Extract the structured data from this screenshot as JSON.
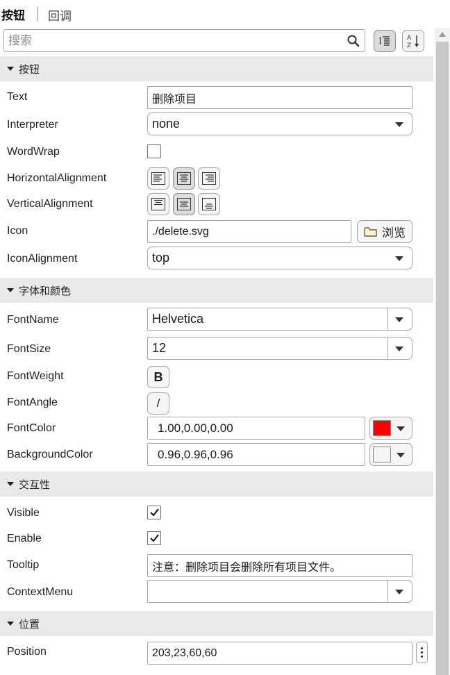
{
  "tabs": {
    "active": "按钮",
    "inactive": "回调"
  },
  "search": {
    "placeholder": "搜索"
  },
  "sections": {
    "button": "按钮",
    "font_color": "字体和颜色",
    "interactivity": "交互性",
    "position": "位置"
  },
  "properties": {
    "text": {
      "label": "Text",
      "value": "删除项目"
    },
    "interpreter": {
      "label": "Interpreter",
      "value": "none"
    },
    "wordwrap": {
      "label": "WordWrap",
      "checked": false
    },
    "horizontal_alignment": {
      "label": "HorizontalAlignment"
    },
    "vertical_alignment": {
      "label": "VerticalAlignment"
    },
    "icon": {
      "label": "Icon",
      "value": "./delete.svg",
      "browse_label": "浏览"
    },
    "icon_alignment": {
      "label": "IconAlignment",
      "value": "top"
    },
    "font_name": {
      "label": "FontName",
      "value": "Helvetica"
    },
    "font_size": {
      "label": "FontSize",
      "value": "12"
    },
    "font_weight": {
      "label": "FontWeight",
      "button": "B"
    },
    "font_angle": {
      "label": "FontAngle",
      "button": "/"
    },
    "font_color": {
      "label": "FontColor",
      "value": "1.00,0.00,0.00",
      "swatch": "#ff0000"
    },
    "background_color": {
      "label": "BackgroundColor",
      "value": "0.96,0.96,0.96",
      "swatch": "#f5f5f5"
    },
    "visible": {
      "label": "Visible",
      "checked": true
    },
    "enable": {
      "label": "Enable",
      "checked": true
    },
    "tooltip": {
      "label": "Tooltip",
      "value": "注意：删除项目会删除所有项目文件。"
    },
    "context_menu": {
      "label": "ContextMenu",
      "value": ""
    },
    "position": {
      "label": "Position",
      "value": "203,23,60,60"
    }
  }
}
